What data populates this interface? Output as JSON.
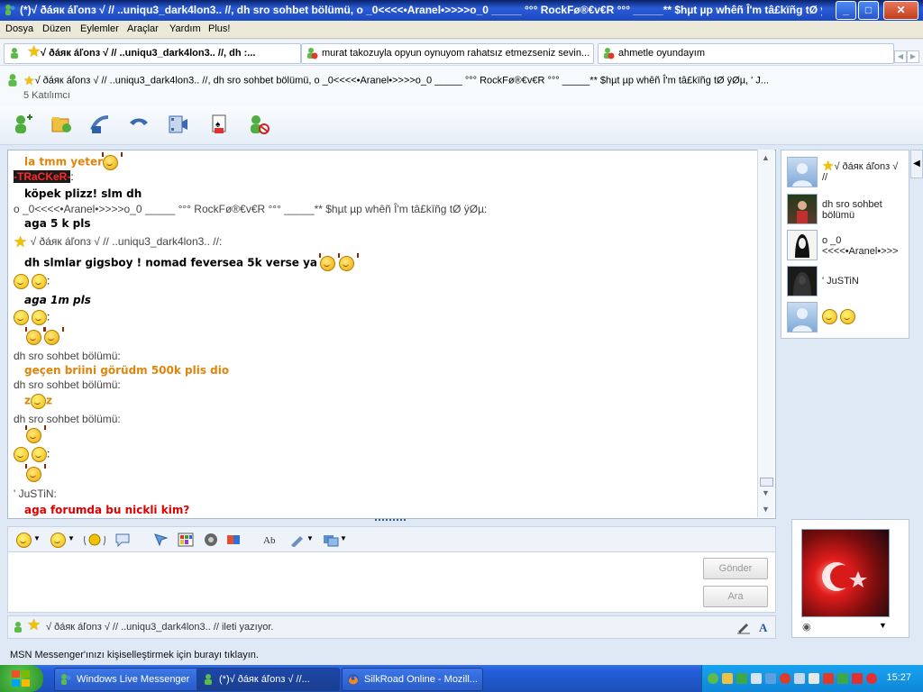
{
  "window": {
    "title": "(*)√ ðáяк áľonз √  // ..uniqu3_dark4lon3.. //, dh sro sohbet bölümü, o _0<<<<•Aranel•>>>>o_0 _____ °°° RockFø®€v€R °°° _____** $hµt µp whêñ Î'm tâ£kïñg tØ ÿØµ, ' J..."
  },
  "menu": [
    "Dosya",
    "Düzen",
    "Eylemler",
    "Araçlar",
    "Yardım",
    "Plus!"
  ],
  "tabs": [
    {
      "label": "√ ðáяк áľonз √  // ..uniqu3_dark4lon3.. //, dh :..."
    },
    {
      "label": "murat takozuyla opyun oynuyom rahatsız etmezseniz sevin..."
    },
    {
      "label": "ahmetle oyundayım"
    }
  ],
  "conversation": {
    "header": "√ ðáяк áľonз √   // ..uniqu3_dark4lon3.. //, dh sro sohbet bölümü, o _0<<<<•Aranel•>>>>o_0 _____ °°° RockFø®€v€R °°° _____** $hµt µp whêñ Î'm tâ£kïñg tØ ÿØµ, ' J...",
    "participants": "5 Katılımcı"
  },
  "chat": {
    "l1": "la tmm yeter",
    "l2_nick": "-TRaCKeR-",
    "l2_colon": ":",
    "l3": "köpek plizz! slm   dh",
    "l4": "o _0<<<<•Aranel•>>>>o_0 _____ °°° RockFø®€v€R °°° _____** $hµt µp whêñ Î'm tâ£kïñg tØ ÿØµ:",
    "l5": "aga 5 k pls",
    "l6": "√ ðáяк áľonз √   // ..uniqu3_dark4lon3.. //:",
    "l7": "dh slmlar gigsboy ! nomad feversea 5k verse ya",
    "colon": ":",
    "l9": "aga 1m pls",
    "l12": "dh sro sohbet bölümü:",
    "l13": "geçen briini görüdm 500k plis dio",
    "l14": "dh sro sohbet bölümü:",
    "l15a": "z",
    "l15b": "z",
    "l16": "dh sro sohbet bölümü:",
    "l20": "' JuSTiN:",
    "l21": "aga forumda bu nickli kim?"
  },
  "buttons": {
    "send": "Gönder",
    "search": "Ara"
  },
  "typing": "√ ðáяк áľonз √   // ..uniqu3_dark4lon3.. // ileti yazıyor.",
  "participants_panel": [
    {
      "name": "√ ðáяк áľonз √   //"
    },
    {
      "name": "dh sro sohbet bölümü"
    },
    {
      "name": "o _0 <<<<•Aranel•>>>"
    },
    {
      "name": "' JuSTiN"
    },
    {
      "name": ""
    }
  ],
  "ad": "MSN Messenger'ınızı kişiselleştirmek için burayı tıklayın.",
  "taskbar": {
    "items": [
      {
        "label": "Windows Live Messenger"
      },
      {
        "label": "(*)√ ðáяк áľonз √   //..."
      },
      {
        "label": "SilkRoad Online - Mozill..."
      }
    ],
    "clock": "15:27"
  },
  "colors": {
    "orange": "#e0850a",
    "red": "#e00000",
    "tracker_bg": "#1a1a1a",
    "tracker_fg": "#ff2a2a"
  }
}
